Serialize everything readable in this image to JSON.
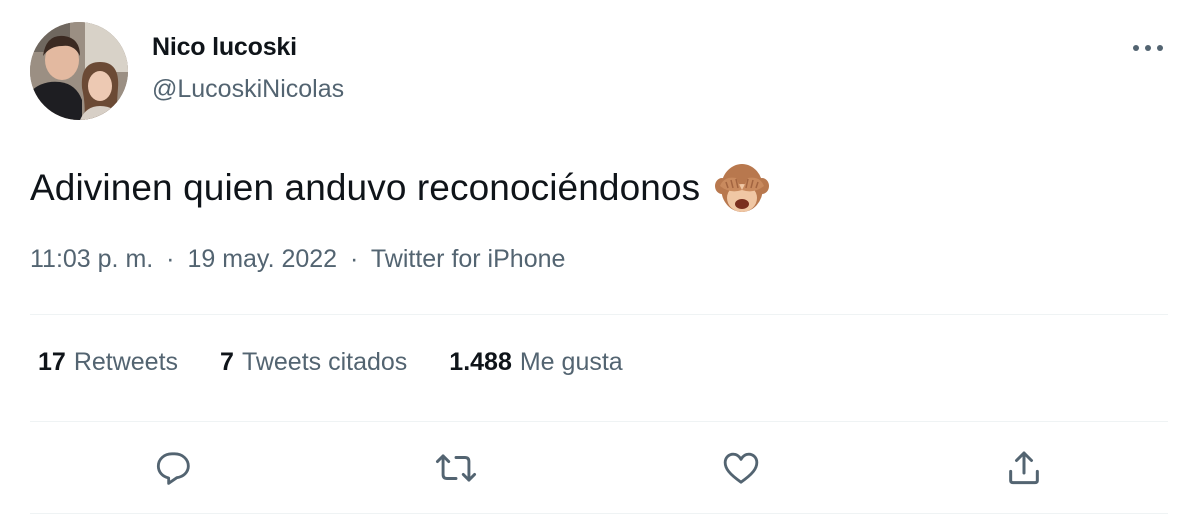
{
  "author": {
    "name": "Nico lucoski",
    "handle": "@LucoskiNicolas"
  },
  "tweet": {
    "text": "Adivinen quien anduvo reconociéndonos",
    "emoji": "see-no-evil-monkey"
  },
  "meta": {
    "time": "11:03 p. m.",
    "separator": "·",
    "date": "19 may. 2022",
    "source": "Twitter for iPhone"
  },
  "stats": [
    {
      "count": "17",
      "label": "Retweets"
    },
    {
      "count": "7",
      "label": "Tweets citados"
    },
    {
      "count": "1.488",
      "label": "Me gusta"
    }
  ],
  "actions": [
    "reply-icon",
    "retweet-icon",
    "like-icon",
    "share-icon"
  ],
  "colors": {
    "text_primary": "#0f1419",
    "text_secondary": "#536471",
    "divider": "#eff3f4",
    "icon": "#536471"
  }
}
